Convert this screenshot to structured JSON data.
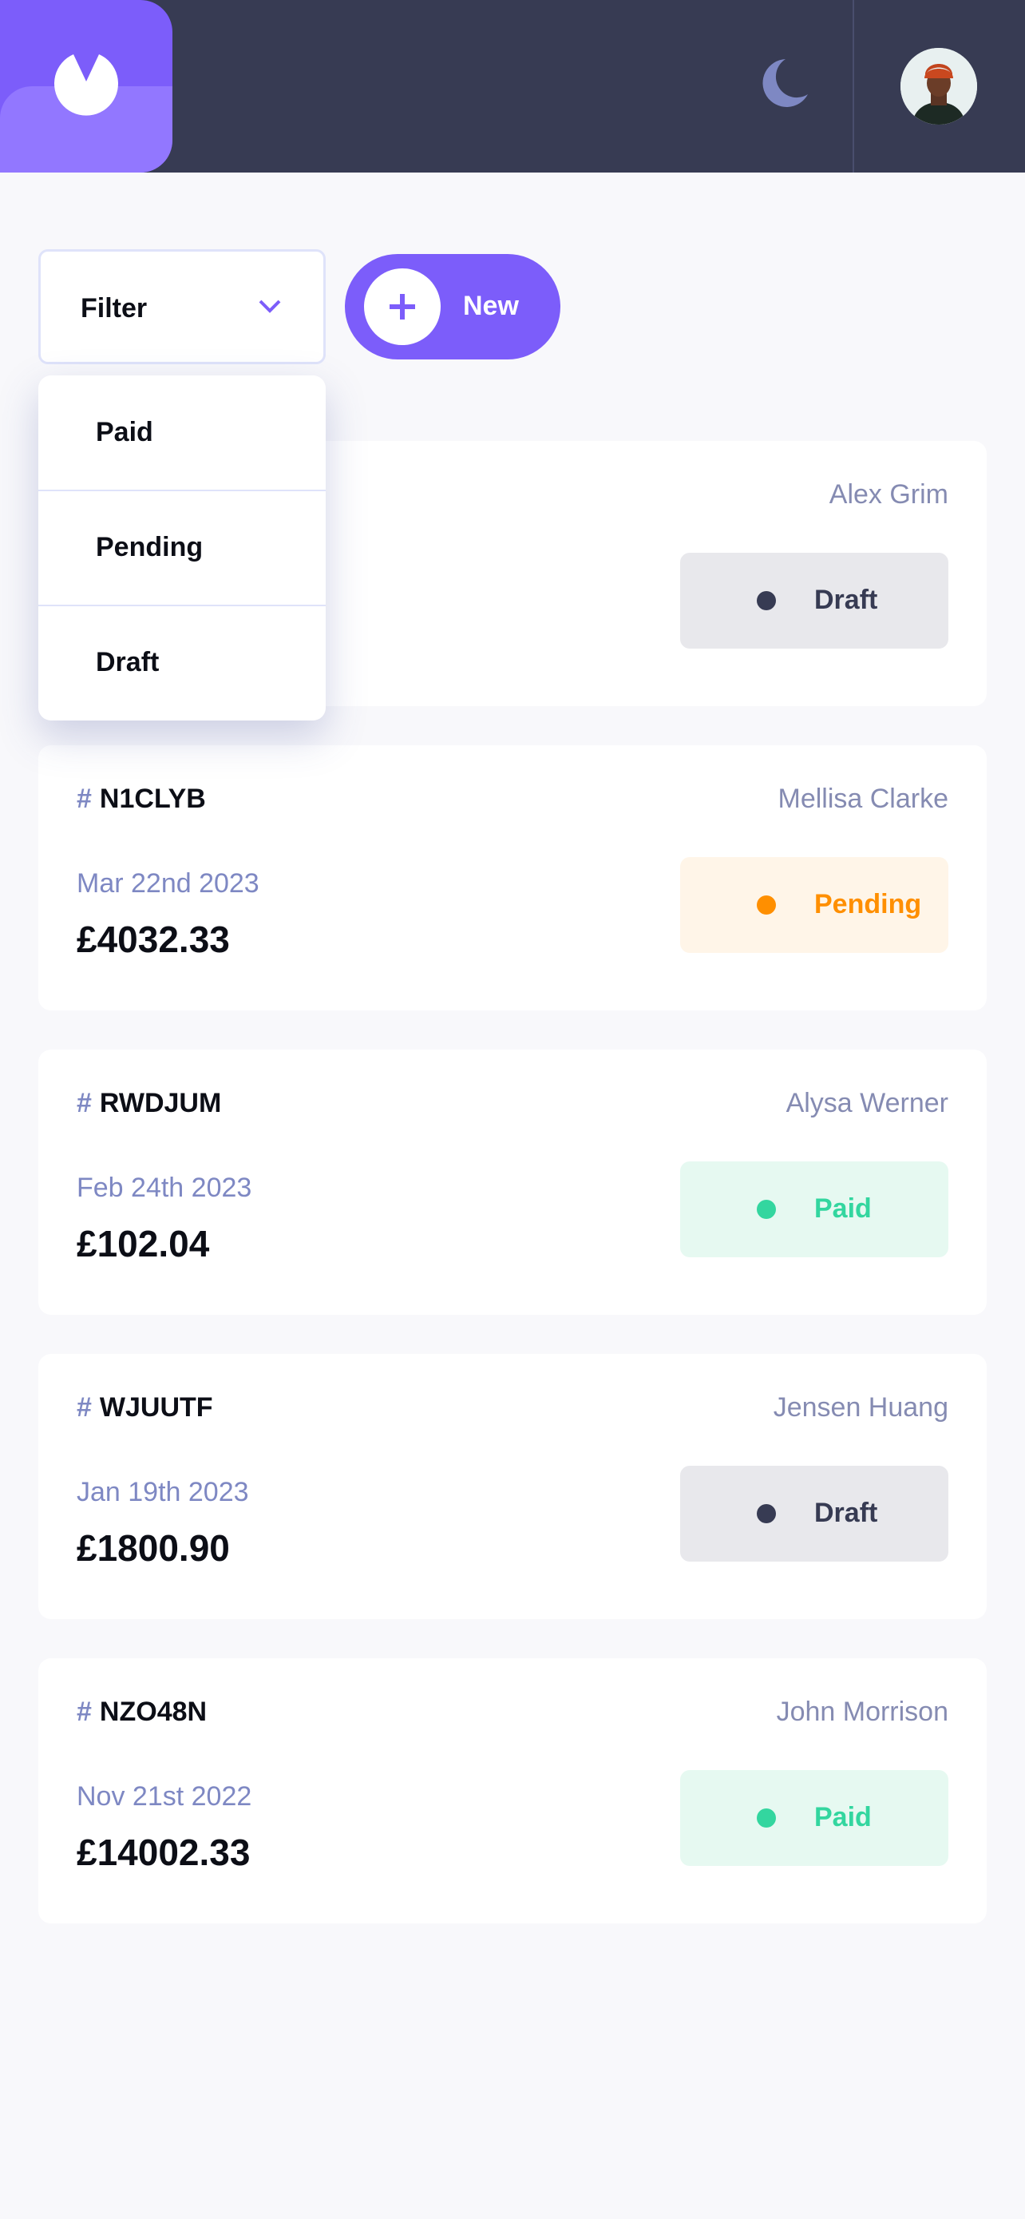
{
  "header": {
    "logo_icon": "logo-icon",
    "theme_toggle_icon": "moon-icon",
    "avatar": "user-avatar"
  },
  "toolbar": {
    "filter_label": "Filter",
    "filter_icon": "chevron-down-icon",
    "new_label": "New",
    "new_icon": "plus-icon"
  },
  "filter_menu": {
    "options": [
      "Paid",
      "Pending",
      "Draft"
    ]
  },
  "colors": {
    "accent": "#7c5dfa",
    "header_bg": "#373b53",
    "draft": "#373b53",
    "pending": "#ff8f00",
    "paid": "#33d69f"
  },
  "invoices": [
    {
      "id": "",
      "client": "Alex Grim",
      "due": "",
      "amount": "",
      "status": "Draft"
    },
    {
      "id": "N1CLYB",
      "client": "Mellisa Clarke",
      "due": "Mar 22nd 2023",
      "amount": "£4032.33",
      "status": "Pending"
    },
    {
      "id": "RWDJUM",
      "client": "Alysa Werner",
      "due": "Feb 24th 2023",
      "amount": "£102.04",
      "status": "Paid"
    },
    {
      "id": "WJUUTF",
      "client": "Jensen Huang",
      "due": "Jan 19th 2023",
      "amount": "£1800.90",
      "status": "Draft"
    },
    {
      "id": "NZO48N",
      "client": "John Morrison",
      "due": "Nov 21st 2022",
      "amount": "£14002.33",
      "status": "Paid"
    }
  ]
}
